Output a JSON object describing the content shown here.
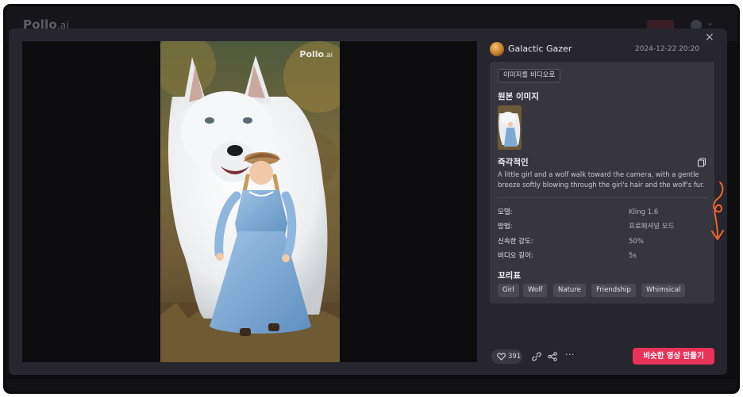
{
  "app": {
    "brand_main": "Pollo",
    "brand_suffix": ".ai"
  },
  "modal": {
    "close_glyph": "×",
    "watermark": {
      "main": "Pollo",
      "suffix": ".ai"
    },
    "author": {
      "name": "Galactic Gazer",
      "date": "2024-12-22 20:20"
    },
    "tag_button": "이미지를 비디오로",
    "source_heading": "원본 이미지",
    "prompt_heading": "즉각적인",
    "prompt_text": "A little girl and a wolf walk toward the camera, with a gentle breeze softly blowing through the girl's hair and the wolf's fur.",
    "details": [
      {
        "label": "모델:",
        "value": "Kling 1.6"
      },
      {
        "label": "방법:",
        "value": "프로페셔널 모드"
      },
      {
        "label": "신속한 강도:",
        "value": "50%"
      },
      {
        "label": "비디오 길이:",
        "value": "5s"
      }
    ],
    "tags_heading": "꼬리표",
    "tags": [
      "Girl",
      "Wolf",
      "Nature",
      "Friendship",
      "Whimsical"
    ],
    "likes": "391",
    "cta_label": "비슷한 영상 만들기"
  },
  "colors": {
    "accent": "#e8335b",
    "panel": "#37363f",
    "modal": "#27262e",
    "annotation": "#f0642d"
  },
  "icons": [
    "close-icon",
    "heart-icon",
    "link-icon",
    "share-icon",
    "more-icon",
    "copy-icon"
  ]
}
